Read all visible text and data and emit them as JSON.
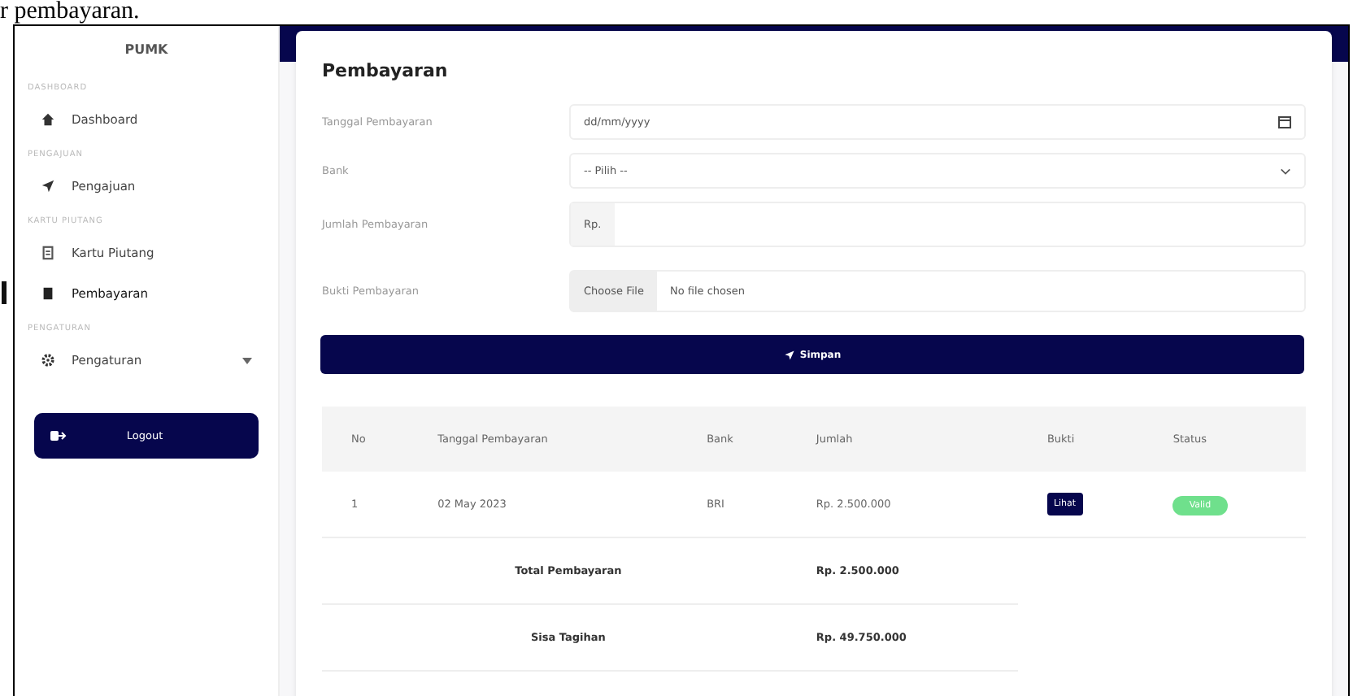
{
  "caption": "r pembayaran.",
  "sidebar": {
    "brand": "PUMK",
    "sections": [
      {
        "heading": "DASHBOARD",
        "items": [
          {
            "label": "Dashboard",
            "selected": false,
            "expandable": false
          }
        ]
      },
      {
        "heading": "PENGAJUAN",
        "items": [
          {
            "label": "Pengajuan",
            "selected": false,
            "expandable": false
          }
        ]
      },
      {
        "heading": "KARTU PIUTANG",
        "items": [
          {
            "label": "Kartu Piutang",
            "selected": false,
            "expandable": false
          },
          {
            "label": "Pembayaran",
            "selected": true,
            "expandable": false
          }
        ]
      },
      {
        "heading": "PENGATURAN",
        "items": [
          {
            "label": "Pengaturan",
            "selected": false,
            "expandable": true
          }
        ]
      }
    ],
    "logout": "Logout"
  },
  "form": {
    "title": "Pembayaran",
    "fields": [
      {
        "kind": "date",
        "label": "Tanggal Pembayaran",
        "placeholder": "dd/mm/yyyy"
      },
      {
        "kind": "select",
        "label": "Bank",
        "value": "-- Pilih --"
      },
      {
        "kind": "money",
        "label": "Jumlah Pembayaran",
        "prefix": "Rp."
      },
      {
        "kind": "file",
        "label": "Bukti Pembayaran",
        "button": "Choose File",
        "status": "No file chosen"
      }
    ],
    "submit": "Simpan"
  },
  "table": {
    "columns": [
      "No",
      "Tanggal Pembayaran",
      "Bank",
      "Jumlah",
      "Bukti",
      "Status"
    ],
    "rows": [
      {
        "no": "1",
        "date": "02 May 2023",
        "bank": "BRI",
        "amount": "Rp. 2.500.000",
        "proof": "Lihat",
        "status": "Valid"
      }
    ],
    "summary": [
      {
        "label": "Total Pembayaran",
        "value": "Rp. 2.500.000"
      },
      {
        "label": "Sisa Tagihan",
        "value": "Rp. 49.750.000"
      }
    ]
  }
}
